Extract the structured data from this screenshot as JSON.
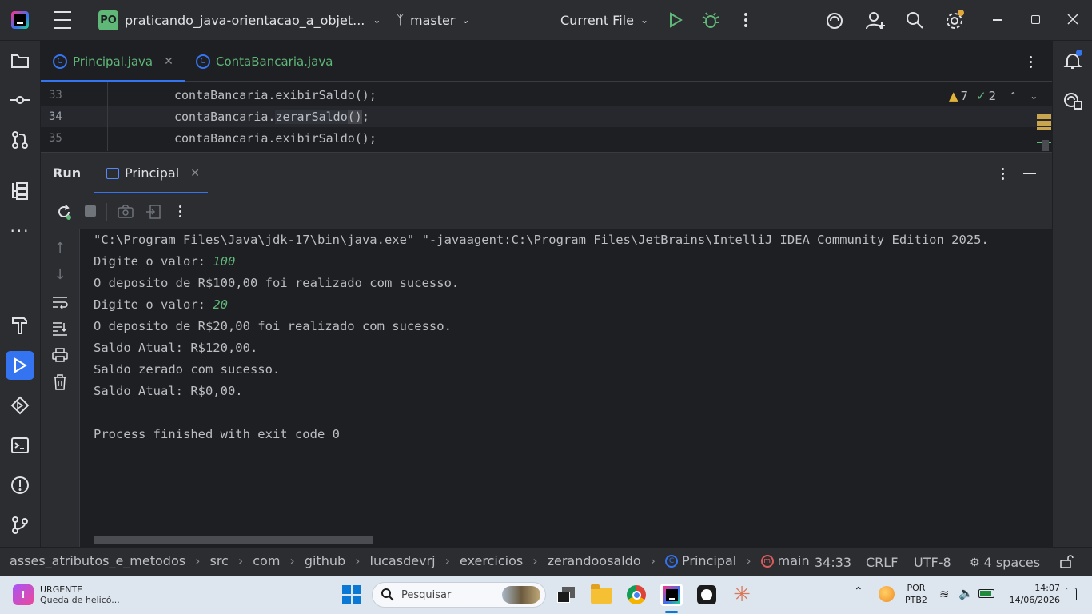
{
  "title_bar": {
    "project_badge": "PO",
    "project_name": "praticando_java-orientacao_a_objet...",
    "branch": "master",
    "run_config": "Current File"
  },
  "editor": {
    "tabs": [
      {
        "label": "Principal.java",
        "active": true
      },
      {
        "label": "ContaBancaria.java",
        "active": false
      }
    ],
    "warnings_count": "7",
    "checks_count": "2",
    "lines": [
      {
        "number": "33",
        "code": "contaBancaria.exibirSaldo();"
      },
      {
        "number": "34",
        "code_prefix": "contaBancaria.",
        "code_method": "zerarSaldo",
        "code_parens": "()",
        "code_suffix": ";"
      },
      {
        "number": "35",
        "code": "contaBancaria.exibirSaldo();"
      }
    ]
  },
  "run_panel": {
    "title": "Run",
    "tab_label": "Principal",
    "console": {
      "command": "\"C:\\Program Files\\Java\\jdk-17\\bin\\java.exe\" \"-javaagent:C:\\Program Files\\JetBrains\\IntelliJ IDEA Community Edition 2025.",
      "prompt1": "Digite o valor: ",
      "input1": "100",
      "line3": "O deposito de R$100,00 foi realizado com sucesso.",
      "prompt2": "Digite o valor: ",
      "input2": "20",
      "line5": "O deposito de R$20,00 foi realizado com sucesso.",
      "line6": "Saldo Atual: R$120,00.",
      "line7": "Saldo zerado com sucesso.",
      "line8": "Saldo Atual: R$0,00.",
      "exit": "Process finished with exit code 0"
    }
  },
  "breadcrumb": [
    "asses_atributos_e_metodos",
    "src",
    "com",
    "github",
    "lucasdevrj",
    "exercicios",
    "zerandoosaldo",
    "Principal",
    "main"
  ],
  "status": {
    "position": "34:33",
    "line_ending": "CRLF",
    "encoding": "UTF-8",
    "indent": "4 spaces"
  },
  "taskbar": {
    "notification_title": "URGENTE",
    "notification_text": "Queda de helicó...",
    "search_placeholder": "Pesquisar",
    "lang_top": "POR",
    "lang_bottom": "PTB2",
    "time": "14:07",
    "date": "14/06/2026"
  },
  "colors": {
    "accent": "#3574f0",
    "run_green": "#5fb878",
    "warning": "#e0b339",
    "background": "#1e1f22",
    "panel": "#2b2d30"
  }
}
